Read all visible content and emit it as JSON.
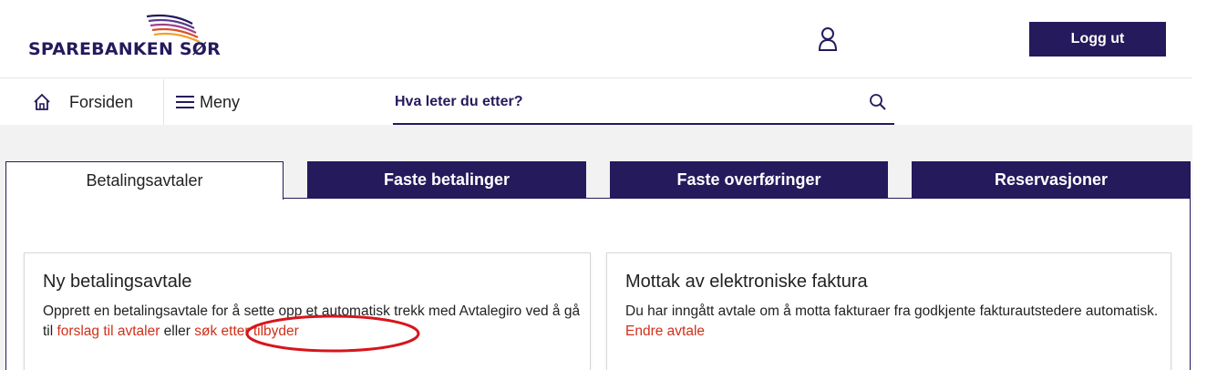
{
  "header": {
    "logo_text": "SPAREBANKEN SØR",
    "logout_label": "Logg ut"
  },
  "nav": {
    "home_label": "Forsiden",
    "menu_label": "Meny",
    "search_placeholder": "Hva leter du etter?"
  },
  "tabs": [
    {
      "label": "Betalingsavtaler",
      "active": true
    },
    {
      "label": "Faste betalinger",
      "active": false
    },
    {
      "label": "Faste overføringer",
      "active": false
    },
    {
      "label": "Reservasjoner",
      "active": false
    }
  ],
  "cards": [
    {
      "title": "Ny betalingsavtale",
      "text_1": "Opprett en betalingsavtale for å sette opp et automatisk trekk med Avtalegiro ved å gå til ",
      "link_1": "forslag til avtaler",
      "text_2": " eller ",
      "link_2": "søk etter tilbyder"
    },
    {
      "title": "Mottak av elektroniske faktura",
      "text_1": "Du har inngått avtale om å motta fakturaer fra godkjente fakturautstedere automatisk. ",
      "link_1": "Endre avtale"
    }
  ],
  "icons": {
    "logo": "sparebanken-logo-mark",
    "user": "user-icon",
    "home": "home-icon",
    "menu": "hamburger-icon",
    "search": "search-icon"
  },
  "colors": {
    "brand": "#241a5c",
    "link": "#d0301a",
    "annotation": "#d8141c",
    "content_bg": "#f2f2f2"
  }
}
